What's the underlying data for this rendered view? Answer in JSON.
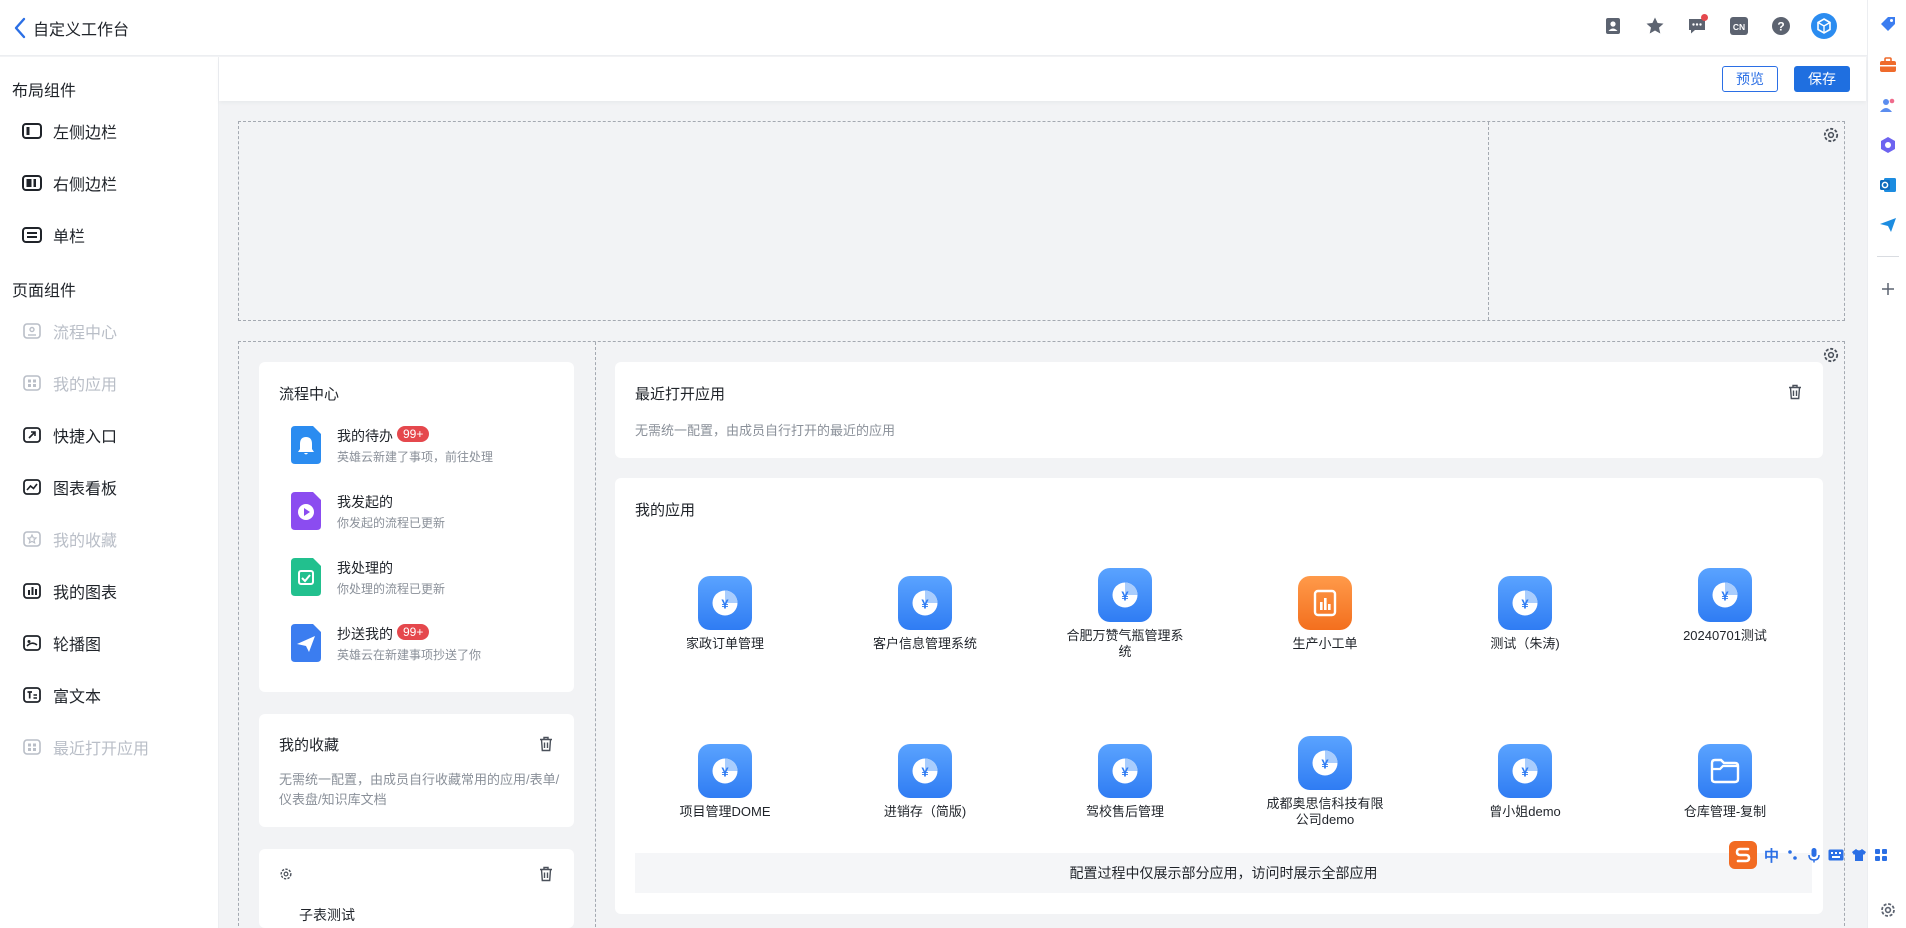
{
  "header": {
    "title": "自定义工作台"
  },
  "toolbar": {
    "preview_label": "预览",
    "save_label": "保存"
  },
  "sidebar": {
    "layout_section": "布局组件",
    "layout_items": [
      {
        "label": "左侧边栏",
        "icon": "left-sidebar-icon"
      },
      {
        "label": "右侧边栏",
        "icon": "right-sidebar-icon"
      },
      {
        "label": "单栏",
        "icon": "single-column-icon"
      }
    ],
    "page_section": "页面组件",
    "page_items": [
      {
        "label": "流程中心",
        "disabled": true
      },
      {
        "label": "我的应用",
        "disabled": true
      },
      {
        "label": "快捷入口",
        "disabled": false
      },
      {
        "label": "图表看板",
        "disabled": false
      },
      {
        "label": "我的收藏",
        "disabled": true
      },
      {
        "label": "我的图表",
        "disabled": false
      },
      {
        "label": "轮播图",
        "disabled": false
      },
      {
        "label": "富文本",
        "disabled": false
      },
      {
        "label": "最近打开应用",
        "disabled": true
      }
    ]
  },
  "flow_center": {
    "title": "流程中心",
    "items": [
      {
        "name": "我的待办",
        "badge": "99+",
        "desc": "英雄云新建了事项，前往处理",
        "color": "#2b8cf0"
      },
      {
        "name": "我发起的",
        "badge": "",
        "desc": "你发起的流程已更新",
        "color": "#8b4cf0"
      },
      {
        "name": "我处理的",
        "badge": "",
        "desc": "你处理的流程已更新",
        "color": "#22c08e"
      },
      {
        "name": "抄送我的",
        "badge": "99+",
        "desc": "英雄云在新建事项抄送了你",
        "color": "#3b7df0"
      }
    ]
  },
  "favorites": {
    "title": "我的收藏",
    "desc": "无需统一配置，由成员自行收藏常用的应用/表单/仪表盘/知识库文档"
  },
  "sub_table": {
    "title": "子表测试"
  },
  "recent_apps": {
    "title": "最近打开应用",
    "desc": "无需统一配置，由成员自行打开的最近的应用"
  },
  "my_apps": {
    "title": "我的应用",
    "apps": [
      {
        "name": "家政订单管理"
      },
      {
        "name": "客户信息管理系统"
      },
      {
        "name": "合肥万赞气瓶管理系统"
      },
      {
        "name": "生产小工单"
      },
      {
        "name": "测试（朱涛)"
      },
      {
        "name": "20240701测试"
      },
      {
        "name": "项目管理DOME"
      },
      {
        "name": "进销存（简版)"
      },
      {
        "name": "驾校售后管理"
      },
      {
        "name": "成都奥思信科技有限公司demo"
      },
      {
        "name": "曾小姐demo"
      },
      {
        "name": "仓库管理-复制"
      }
    ],
    "notice": "配置过程中仅展示部分应用，访问时展示全部应用"
  },
  "ime": {
    "lang": "中"
  }
}
